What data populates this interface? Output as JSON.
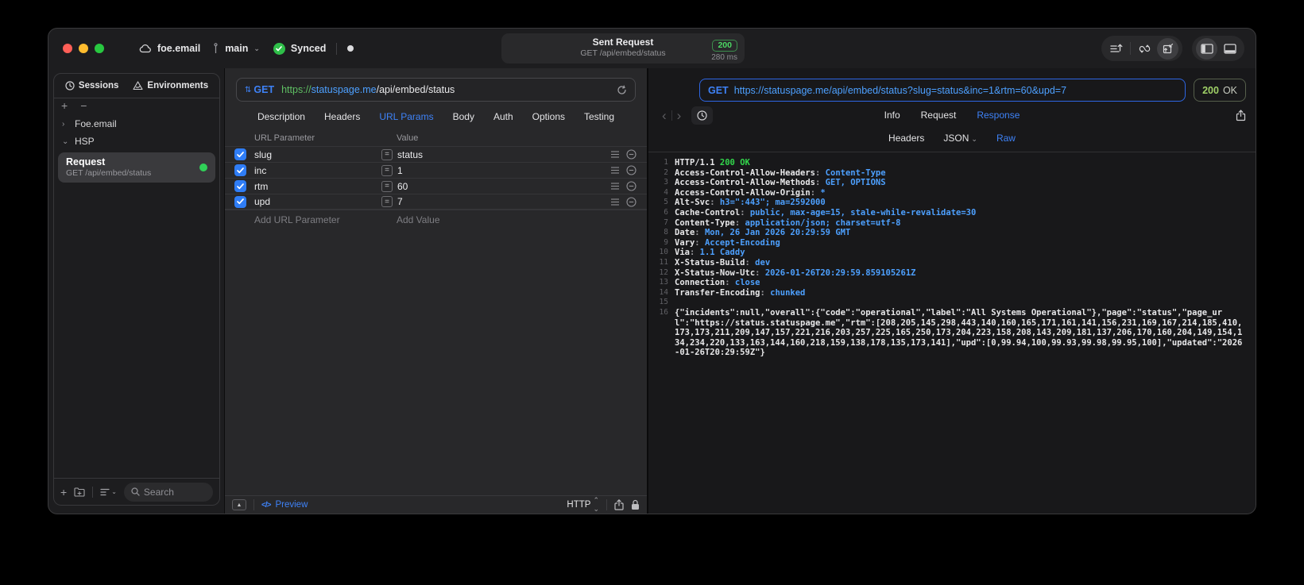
{
  "titlebar": {
    "project": "foe.email",
    "branch": "main",
    "sync_label": "Synced",
    "request_title": "Sent Request",
    "request_subtitle": "GET /api/embed/status",
    "status_code": "200",
    "duration": "280 ms"
  },
  "sidebar": {
    "tabs": [
      {
        "label": "Sessions"
      },
      {
        "label": "Environments"
      }
    ],
    "groups": [
      {
        "label": "Foe.email"
      },
      {
        "label": "HSP"
      }
    ],
    "request_item": {
      "title": "Request",
      "subtitle": "GET /api/embed/status"
    },
    "search_placeholder": "Search"
  },
  "request_panel": {
    "method": "GET",
    "url_scheme": "https://",
    "url_host": "statuspage.me",
    "url_path": "/api/embed/status",
    "tabs": [
      "Description",
      "Headers",
      "URL Params",
      "Body",
      "Auth",
      "Options",
      "Testing"
    ],
    "active_tab": "URL Params",
    "table": {
      "col_param": "URL Parameter",
      "col_value": "Value",
      "rows": [
        {
          "name": "slug",
          "value": "status",
          "enabled": true
        },
        {
          "name": "inc",
          "value": "1",
          "enabled": true
        },
        {
          "name": "rtm",
          "value": "60",
          "enabled": true
        },
        {
          "name": "upd",
          "value": "7",
          "enabled": true
        }
      ],
      "add_param": "Add URL Parameter",
      "add_value": "Add Value"
    },
    "footer": {
      "preview": "Preview",
      "code_glyph": "</>",
      "protocol": "HTTP"
    }
  },
  "response_panel": {
    "method": "GET",
    "url": "https://statuspage.me/api/embed/status?slug=status&inc=1&rtm=60&upd=7",
    "status_code": "200",
    "status_text": "OK",
    "tabs": [
      "Info",
      "Request",
      "Response"
    ],
    "active_tab": "Response",
    "subtabs": [
      "Headers",
      "JSON",
      "Raw"
    ],
    "active_subtab": "Raw",
    "code_lines": [
      {
        "n": "1",
        "parts": [
          {
            "c": "w",
            "t": "HTTP/1.1 "
          },
          {
            "c": "g",
            "t": "200 OK"
          }
        ]
      },
      {
        "n": "2",
        "parts": [
          {
            "c": "w",
            "t": "Access-Control-Allow-Headers"
          },
          {
            "c": "d",
            "t": ": "
          },
          {
            "c": "b",
            "t": "Content-Type"
          }
        ]
      },
      {
        "n": "3",
        "parts": [
          {
            "c": "w",
            "t": "Access-Control-Allow-Methods"
          },
          {
            "c": "d",
            "t": ": "
          },
          {
            "c": "b",
            "t": "GET, OPTIONS"
          }
        ]
      },
      {
        "n": "4",
        "parts": [
          {
            "c": "w",
            "t": "Access-Control-Allow-Origin"
          },
          {
            "c": "d",
            "t": ": "
          },
          {
            "c": "b",
            "t": "*"
          }
        ]
      },
      {
        "n": "5",
        "parts": [
          {
            "c": "w",
            "t": "Alt-Svc"
          },
          {
            "c": "d",
            "t": ": "
          },
          {
            "c": "b",
            "t": "h3=\":443\"; ma=2592000"
          }
        ]
      },
      {
        "n": "6",
        "parts": [
          {
            "c": "w",
            "t": "Cache-Control"
          },
          {
            "c": "d",
            "t": ": "
          },
          {
            "c": "b",
            "t": "public, max-age=15, stale-while-revalidate=30"
          }
        ]
      },
      {
        "n": "7",
        "parts": [
          {
            "c": "w",
            "t": "Content-Type"
          },
          {
            "c": "d",
            "t": ": "
          },
          {
            "c": "b",
            "t": "application/json; charset=utf-8"
          }
        ]
      },
      {
        "n": "8",
        "parts": [
          {
            "c": "w",
            "t": "Date"
          },
          {
            "c": "d",
            "t": ": "
          },
          {
            "c": "b",
            "t": "Mon, 26 Jan 2026 20:29:59 GMT"
          }
        ]
      },
      {
        "n": "9",
        "parts": [
          {
            "c": "w",
            "t": "Vary"
          },
          {
            "c": "d",
            "t": ": "
          },
          {
            "c": "b",
            "t": "Accept-Encoding"
          }
        ]
      },
      {
        "n": "10",
        "parts": [
          {
            "c": "w",
            "t": "Via"
          },
          {
            "c": "d",
            "t": ": "
          },
          {
            "c": "b",
            "t": "1.1 Caddy"
          }
        ]
      },
      {
        "n": "11",
        "parts": [
          {
            "c": "w",
            "t": "X-Status-Build"
          },
          {
            "c": "d",
            "t": ": "
          },
          {
            "c": "b",
            "t": "dev"
          }
        ]
      },
      {
        "n": "12",
        "parts": [
          {
            "c": "w",
            "t": "X-Status-Now-Utc"
          },
          {
            "c": "d",
            "t": ": "
          },
          {
            "c": "b",
            "t": "2026-01-26T20:29:59.859105261Z"
          }
        ]
      },
      {
        "n": "13",
        "parts": [
          {
            "c": "w",
            "t": "Connection"
          },
          {
            "c": "d",
            "t": ": "
          },
          {
            "c": "b",
            "t": "close"
          }
        ]
      },
      {
        "n": "14",
        "parts": [
          {
            "c": "w",
            "t": "Transfer-Encoding"
          },
          {
            "c": "d",
            "t": ": "
          },
          {
            "c": "b",
            "t": "chunked"
          }
        ]
      },
      {
        "n": "15",
        "parts": []
      },
      {
        "n": "16",
        "parts": [
          {
            "c": "w",
            "t": "{\"incidents\":null,\"overall\":{\"code\":\"operational\",\"label\":\"All Systems Operational\"},\"page\":\"status\",\"page_url\":\"https://status.statuspage.me\",\"rtm\":[208,205,145,298,443,140,160,165,171,161,141,156,231,169,167,214,185,410,173,173,211,209,147,157,221,216,203,257,225,165,250,173,204,223,158,208,143,209,181,137,206,170,160,204,149,154,134,234,220,133,163,144,160,218,159,138,178,135,173,141],\"upd\":[0,99.94,100,99.93,99.98,99.95,100],\"updated\":\"2026-01-26T20:29:59Z\"}"
          }
        ]
      }
    ]
  },
  "colors": {
    "accent_blue": "#3e82f7",
    "code_value_blue": "#4da0ff",
    "success_green": "#30d158",
    "status_olive_green": "#9fd067",
    "url_scheme_green": "#5fbf63"
  }
}
